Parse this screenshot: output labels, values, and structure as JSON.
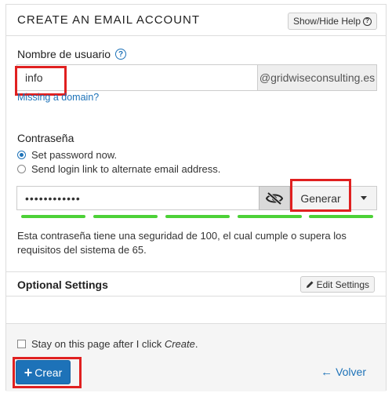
{
  "header": {
    "title": "CREATE AN EMAIL ACCOUNT",
    "help_button": "Show/Hide Help"
  },
  "username": {
    "label": "Nombre de usuario",
    "value": "info",
    "domain": "@gridwiseconsulting.es",
    "missing_domain_link": "Missing a domain?"
  },
  "password": {
    "label": "Contraseña",
    "options": [
      {
        "label": "Set password now.",
        "checked": true
      },
      {
        "label": "Send login link to alternate email address.",
        "checked": false
      }
    ],
    "value": "••••••••••••",
    "generate_button": "Generar",
    "strength_message": "Esta contraseña tiene una seguridad de 100, el cual cumple o supera los requisitos del sistema de 65.",
    "strength_color": "#4cd137"
  },
  "optional": {
    "title": "Optional Settings",
    "edit_button": "Edit Settings"
  },
  "footer": {
    "stay_label_prefix": "Stay on this page after I click ",
    "stay_label_emph": "Create",
    "stay_label_suffix": ".",
    "create_button": "Crear",
    "back_link": "Volver"
  },
  "colors": {
    "primary": "#1d72b8",
    "highlight": "#e02020"
  }
}
